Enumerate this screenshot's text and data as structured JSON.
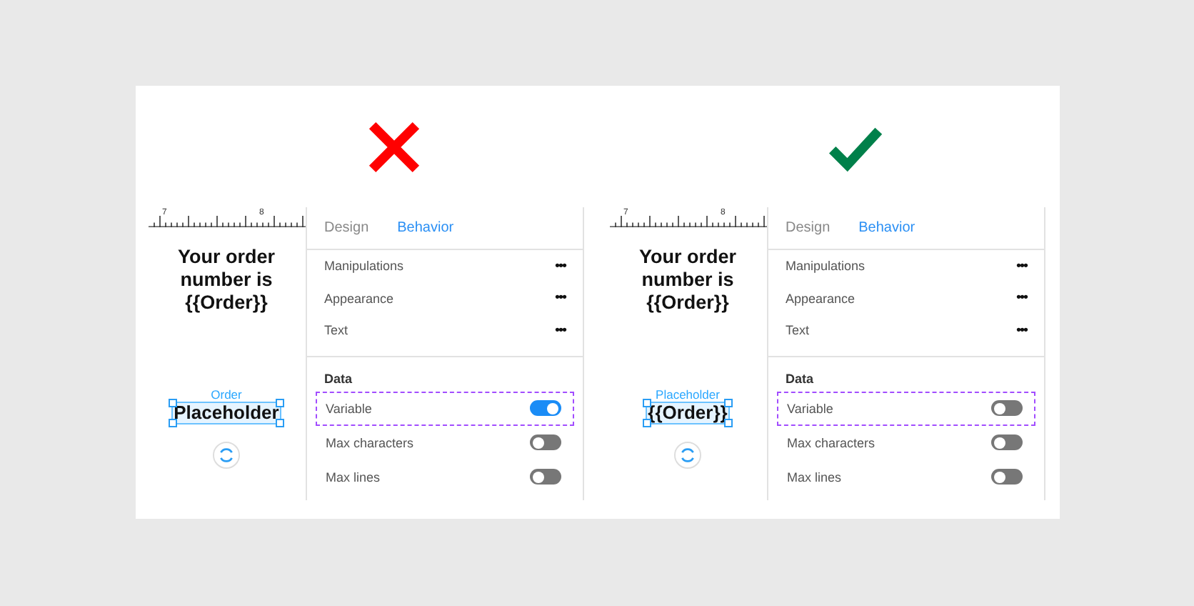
{
  "panels": [
    {
      "kind": "cross",
      "canvas": {
        "ruler_labels": [
          "7",
          "8"
        ],
        "heading_lines": [
          "Your order",
          "number is",
          "{{Order}}"
        ],
        "field_label": "Order",
        "field_value": "Placeholder"
      },
      "tabs": [
        {
          "label": "Design",
          "selected": false
        },
        {
          "label": "Behavior",
          "selected": true
        }
      ],
      "menu_rows": [
        {
          "label": "Manipulations",
          "action": "•••"
        },
        {
          "label": "Appearance",
          "action": "•••"
        },
        {
          "label": "Text",
          "action": "•••"
        }
      ],
      "section_title": "Data",
      "toggles": [
        {
          "label": "Variable",
          "on": true,
          "highlighted": true
        },
        {
          "label": "Max characters",
          "on": false,
          "highlighted": false
        },
        {
          "label": "Max lines",
          "on": false,
          "highlighted": false
        }
      ]
    },
    {
      "kind": "check",
      "canvas": {
        "ruler_labels": [
          "7",
          "8"
        ],
        "heading_lines": [
          "Your order",
          "number is",
          "{{Order}}"
        ],
        "field_label": "Placeholder",
        "field_value": "{{Order}}"
      },
      "tabs": [
        {
          "label": "Design",
          "selected": false
        },
        {
          "label": "Behavior",
          "selected": true
        }
      ],
      "menu_rows": [
        {
          "label": "Manipulations",
          "action": "•••"
        },
        {
          "label": "Appearance",
          "action": "•••"
        },
        {
          "label": "Text",
          "action": "•••"
        }
      ],
      "section_title": "Data",
      "toggles": [
        {
          "label": "Variable",
          "on": false,
          "highlighted": true
        },
        {
          "label": "Max characters",
          "on": false,
          "highlighted": false
        },
        {
          "label": "Max lines",
          "on": false,
          "highlighted": false
        }
      ]
    }
  ]
}
